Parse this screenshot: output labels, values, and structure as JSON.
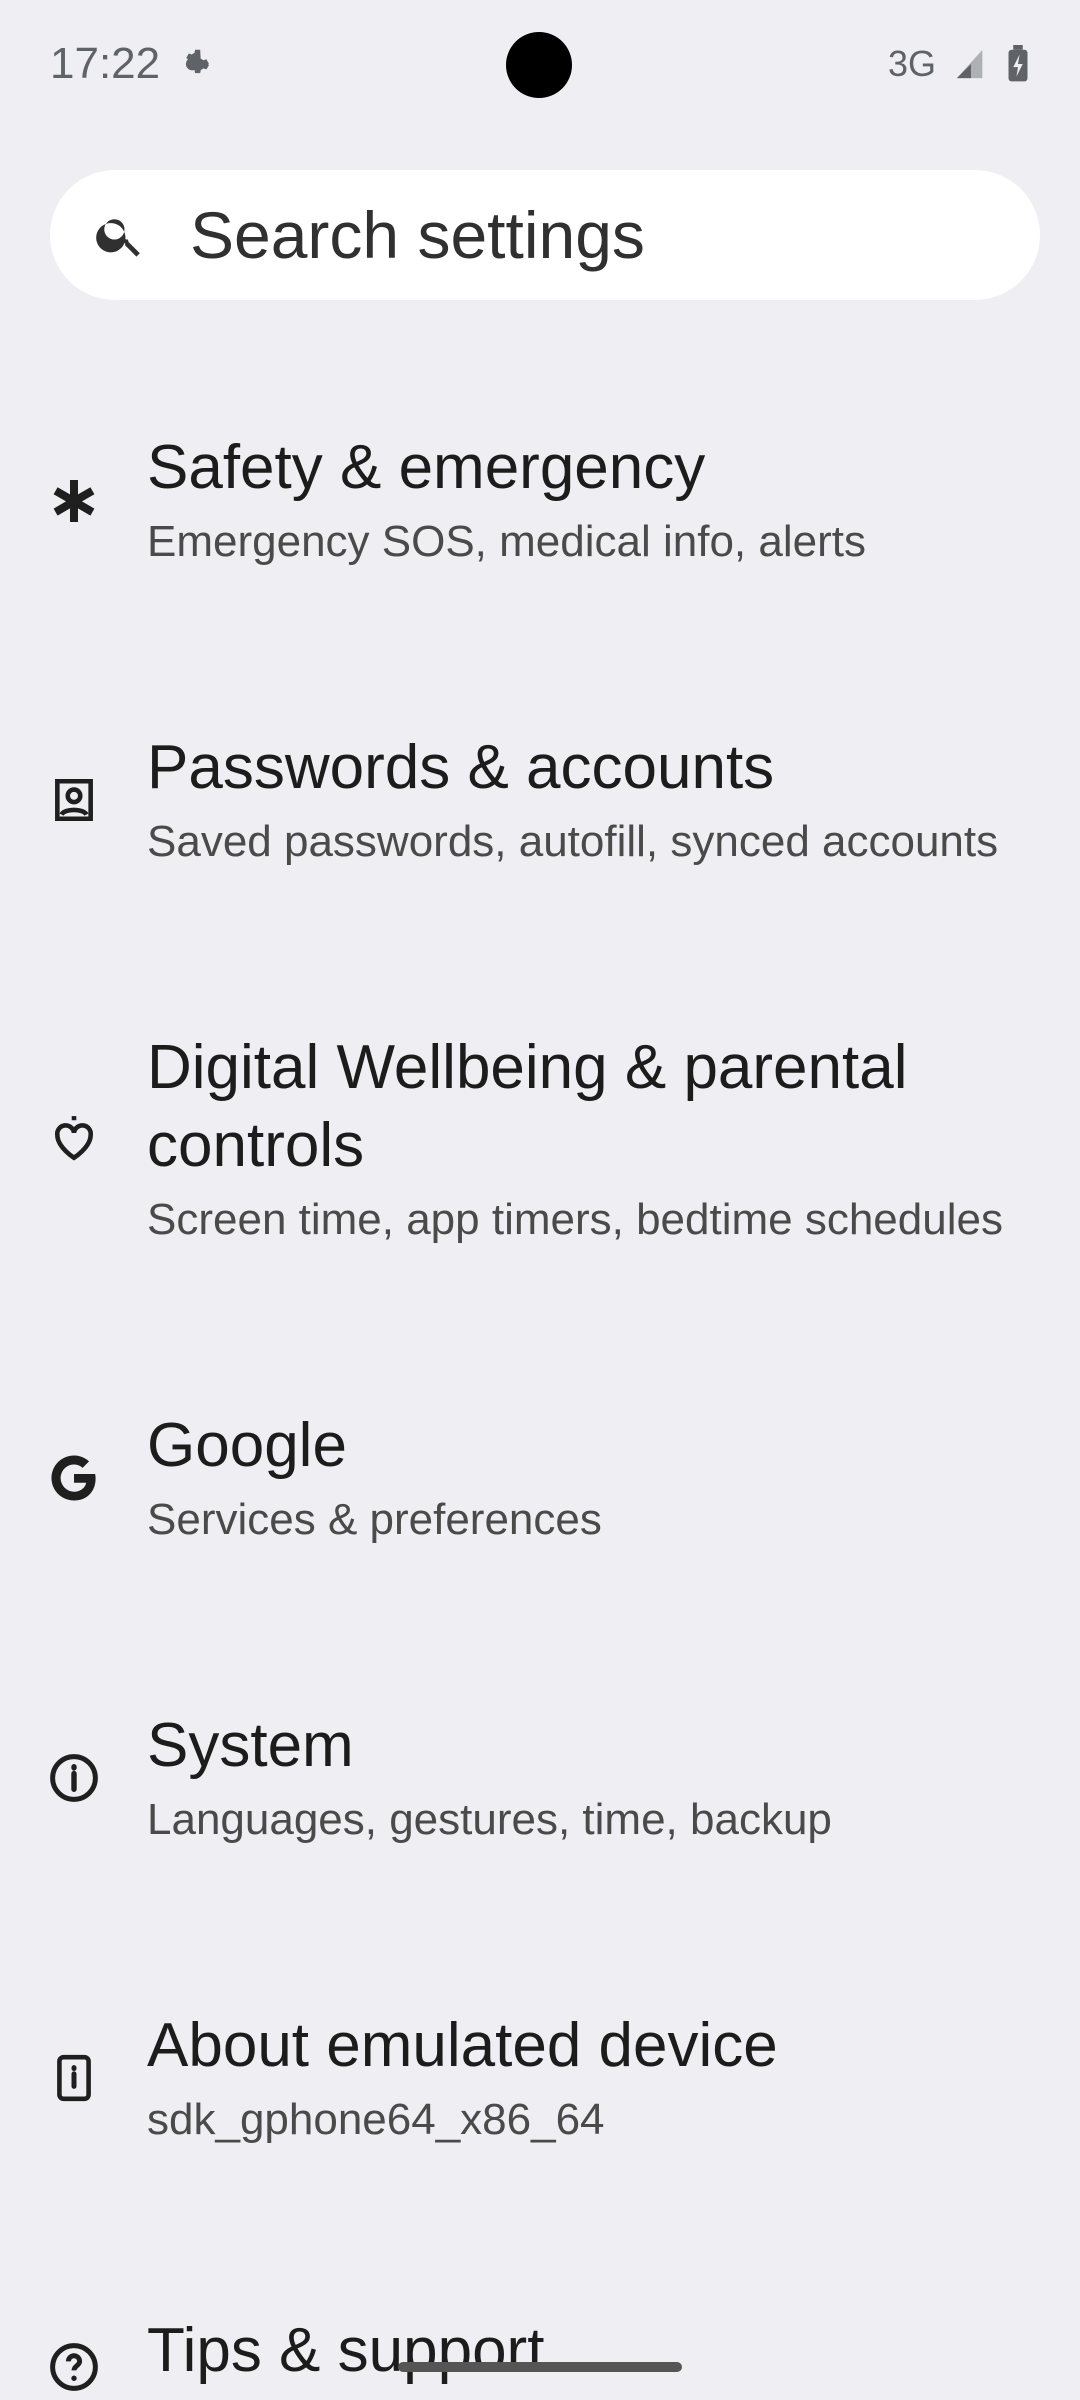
{
  "status_bar": {
    "time": "17:22",
    "network": "3G"
  },
  "search": {
    "placeholder": "Search settings"
  },
  "settings_items": [
    {
      "title": "Safety & emergency",
      "subtitle": "Emergency SOS, medical info, alerts",
      "icon": "asterisk-medical-icon"
    },
    {
      "title": "Passwords & accounts",
      "subtitle": "Saved passwords, autofill, synced accounts",
      "icon": "account-box-icon"
    },
    {
      "title": "Digital Wellbeing & parental controls",
      "subtitle": "Screen time, app timers, bedtime schedules",
      "icon": "wellbeing-heart-icon"
    },
    {
      "title": "Google",
      "subtitle": "Services & preferences",
      "icon": "google-g-icon"
    },
    {
      "title": "System",
      "subtitle": "Languages, gestures, time, backup",
      "icon": "info-circle-icon"
    },
    {
      "title": "About emulated device",
      "subtitle": "sdk_gphone64_x86_64",
      "icon": "device-info-icon"
    },
    {
      "title": "Tips & support",
      "icon": "help-circle-icon"
    }
  ],
  "colors": {
    "background": "#efeff3",
    "search_bg": "#ffffff",
    "text_primary": "#1c1c1c",
    "text_secondary": "#4a4a4a"
  }
}
